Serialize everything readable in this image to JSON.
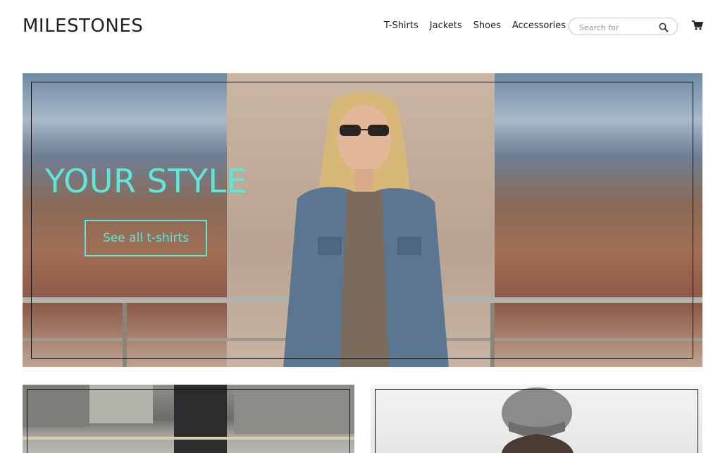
{
  "brand": {
    "logo": "MILESTONES"
  },
  "nav": {
    "items": [
      "T-Shirts",
      "Jackets",
      "Shoes",
      "Accessories"
    ]
  },
  "search": {
    "placeholder": "Search for",
    "icon": "search-icon"
  },
  "cart": {
    "icon": "shopping-cart-icon"
  },
  "hero": {
    "title": "YOUR STYLE",
    "cta_label": "See all t-shirts",
    "accent_color": "#5fe6d9"
  }
}
